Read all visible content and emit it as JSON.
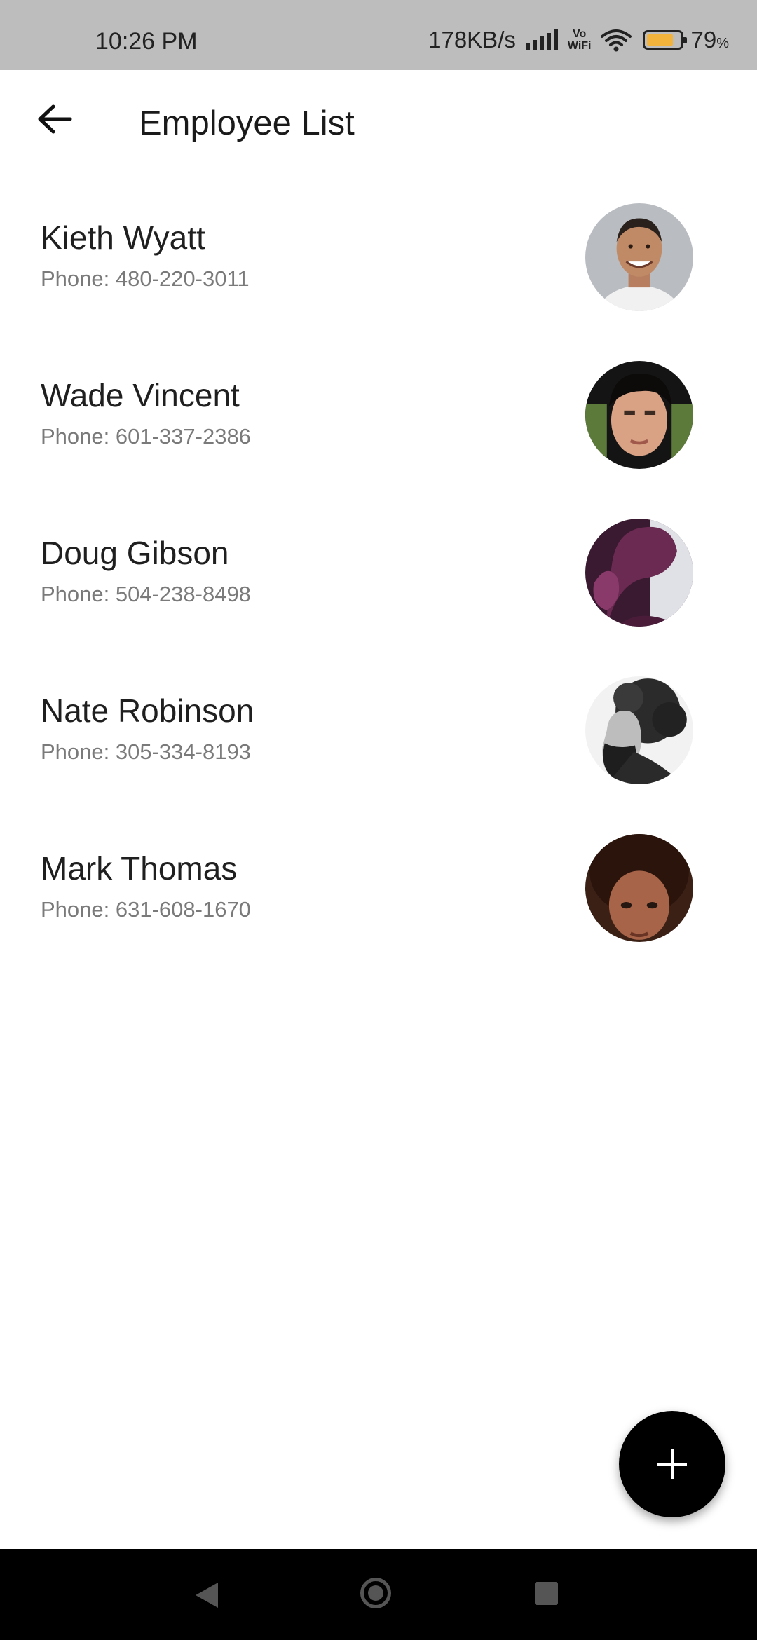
{
  "status_bar": {
    "time": "10:26 PM",
    "net_speed": "178KB/s",
    "vo": "Vo",
    "wifi_label": "WiFi",
    "battery_level": 79,
    "battery_pct": "79",
    "pct_sign": "%"
  },
  "app_bar": {
    "back_icon": "arrow-left-icon",
    "title": "Employee List"
  },
  "employees": [
    {
      "name": "Kieth Wyatt",
      "phone": "Phone: 480-220-3011"
    },
    {
      "name": "Wade Vincent",
      "phone": "Phone: 601-337-2386"
    },
    {
      "name": "Doug Gibson",
      "phone": "Phone: 504-238-8498"
    },
    {
      "name": "Nate Robinson",
      "phone": "Phone: 305-334-8193"
    },
    {
      "name": "Mark Thomas",
      "phone": "Phone: 631-608-1670"
    }
  ],
  "fab": {
    "icon": "plus-icon"
  },
  "nav_bar": {
    "icons": [
      "back-triangle-icon",
      "home-circle-icon",
      "recents-square-icon"
    ]
  }
}
